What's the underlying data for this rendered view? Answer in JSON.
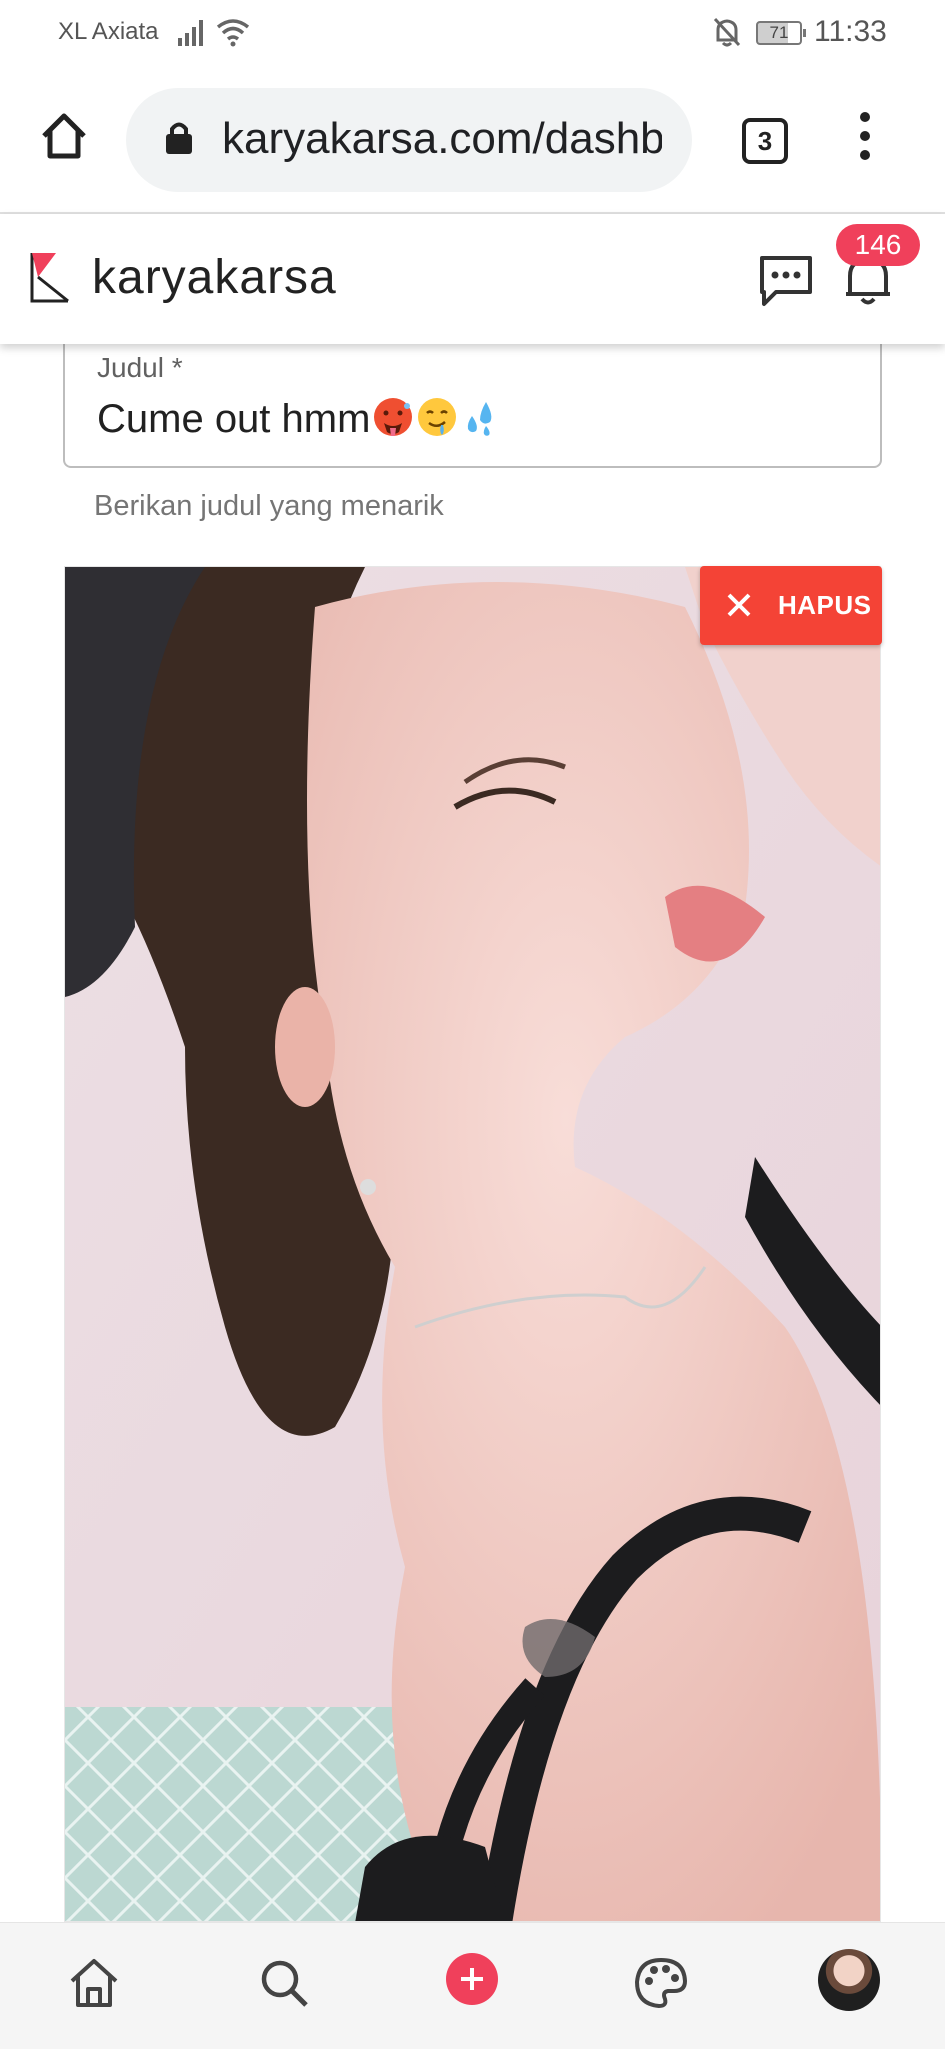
{
  "status_bar": {
    "carrier": "XL Axiata",
    "battery_level": "71",
    "time": "11:33"
  },
  "browser": {
    "url": "karyakarsa.com/dashboard",
    "tab_count": "3"
  },
  "site_header": {
    "brand": "karyakarsa",
    "notification_count": "146"
  },
  "form": {
    "title_label": "Judul *",
    "title_value": "Cume out hmm",
    "title_emojis": [
      "hot-face",
      "drooling-face",
      "sweat-droplets"
    ],
    "title_helper": "Berikan judul yang menarik"
  },
  "image_card": {
    "delete_label": "HAPUS"
  },
  "bottom_nav": {
    "items": [
      "home",
      "search",
      "create",
      "palette",
      "profile-avatar"
    ]
  },
  "colors": {
    "brand_accent": "#f0405b",
    "delete_button": "#f44336",
    "field_border": "#bdbdbd",
    "url_bar": "#f1f3f4"
  }
}
